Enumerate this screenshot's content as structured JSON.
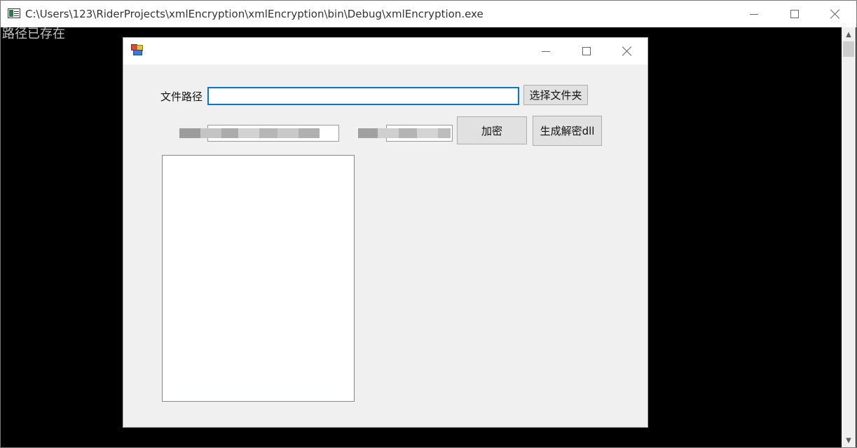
{
  "console": {
    "title": "C:\\Users\\123\\RiderProjects\\xmlEncryption\\xmlEncryption\\bin\\Debug\\xmlEncryption.exe",
    "output_line": "路径已存在"
  },
  "form": {
    "title": "",
    "file_path_label": "文件路径",
    "file_path_value": "",
    "select_folder_button": "选择文件夹",
    "encrypt_button": "加密",
    "generate_dll_button": "生成解密dll",
    "list_items": []
  }
}
